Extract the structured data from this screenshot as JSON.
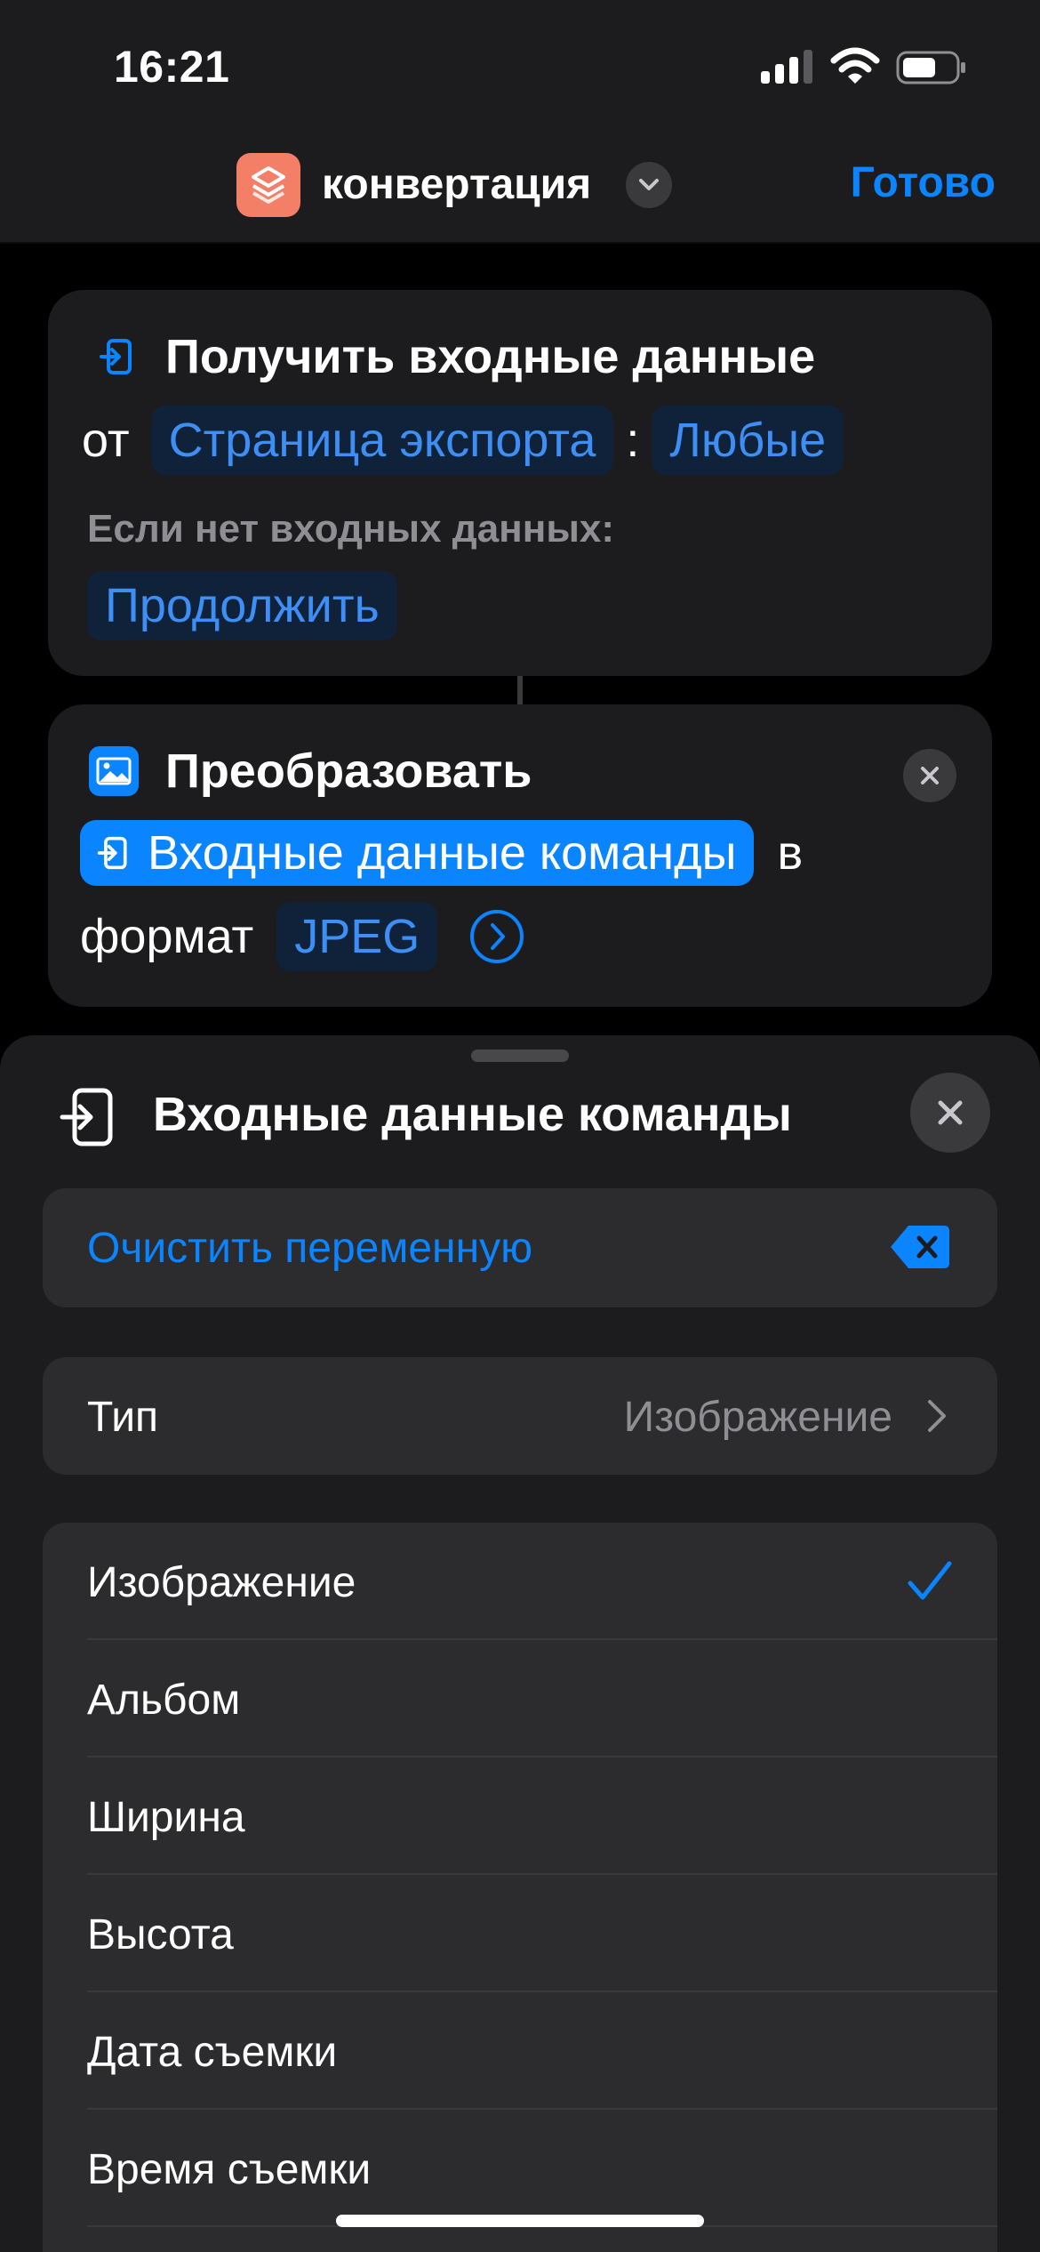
{
  "status_bar": {
    "time": "16:21"
  },
  "nav": {
    "title": "конвертация",
    "done_label": "Готово"
  },
  "actions": {
    "get_input": {
      "title": "Получить входные данные",
      "from_word": "от",
      "source_token": "Страница экспорта",
      "colon": ":",
      "type_token": "Любые",
      "if_none_label": "Если нет входных данных:",
      "if_none_token": "Продолжить"
    },
    "convert": {
      "title": "Преобразовать",
      "input_token": "Входные данные команды",
      "in_word": "в",
      "format_word": "формат",
      "format_token": "JPEG"
    }
  },
  "sheet": {
    "title": "Входные данные команды",
    "clear_label": "Очистить переменную",
    "type_label": "Тип",
    "type_value": "Изображение",
    "options": [
      {
        "label": "Изображение",
        "selected": true
      },
      {
        "label": "Альбом",
        "selected": false
      },
      {
        "label": "Ширина",
        "selected": false
      },
      {
        "label": "Высота",
        "selected": false
      },
      {
        "label": "Дата съемки",
        "selected": false
      },
      {
        "label": "Время съемки",
        "selected": false
      }
    ]
  },
  "colors": {
    "accent": "#0A84FF",
    "app_icon": "#F27F66",
    "card_bg": "#1C1C1E",
    "row_bg": "#2C2C2E"
  },
  "icons": {
    "app": "shortcuts-layers-icon",
    "get_input": "input-arrow-icon",
    "convert": "photo-icon",
    "clear": "delete-backward-icon",
    "selected": "checkmark-icon"
  }
}
